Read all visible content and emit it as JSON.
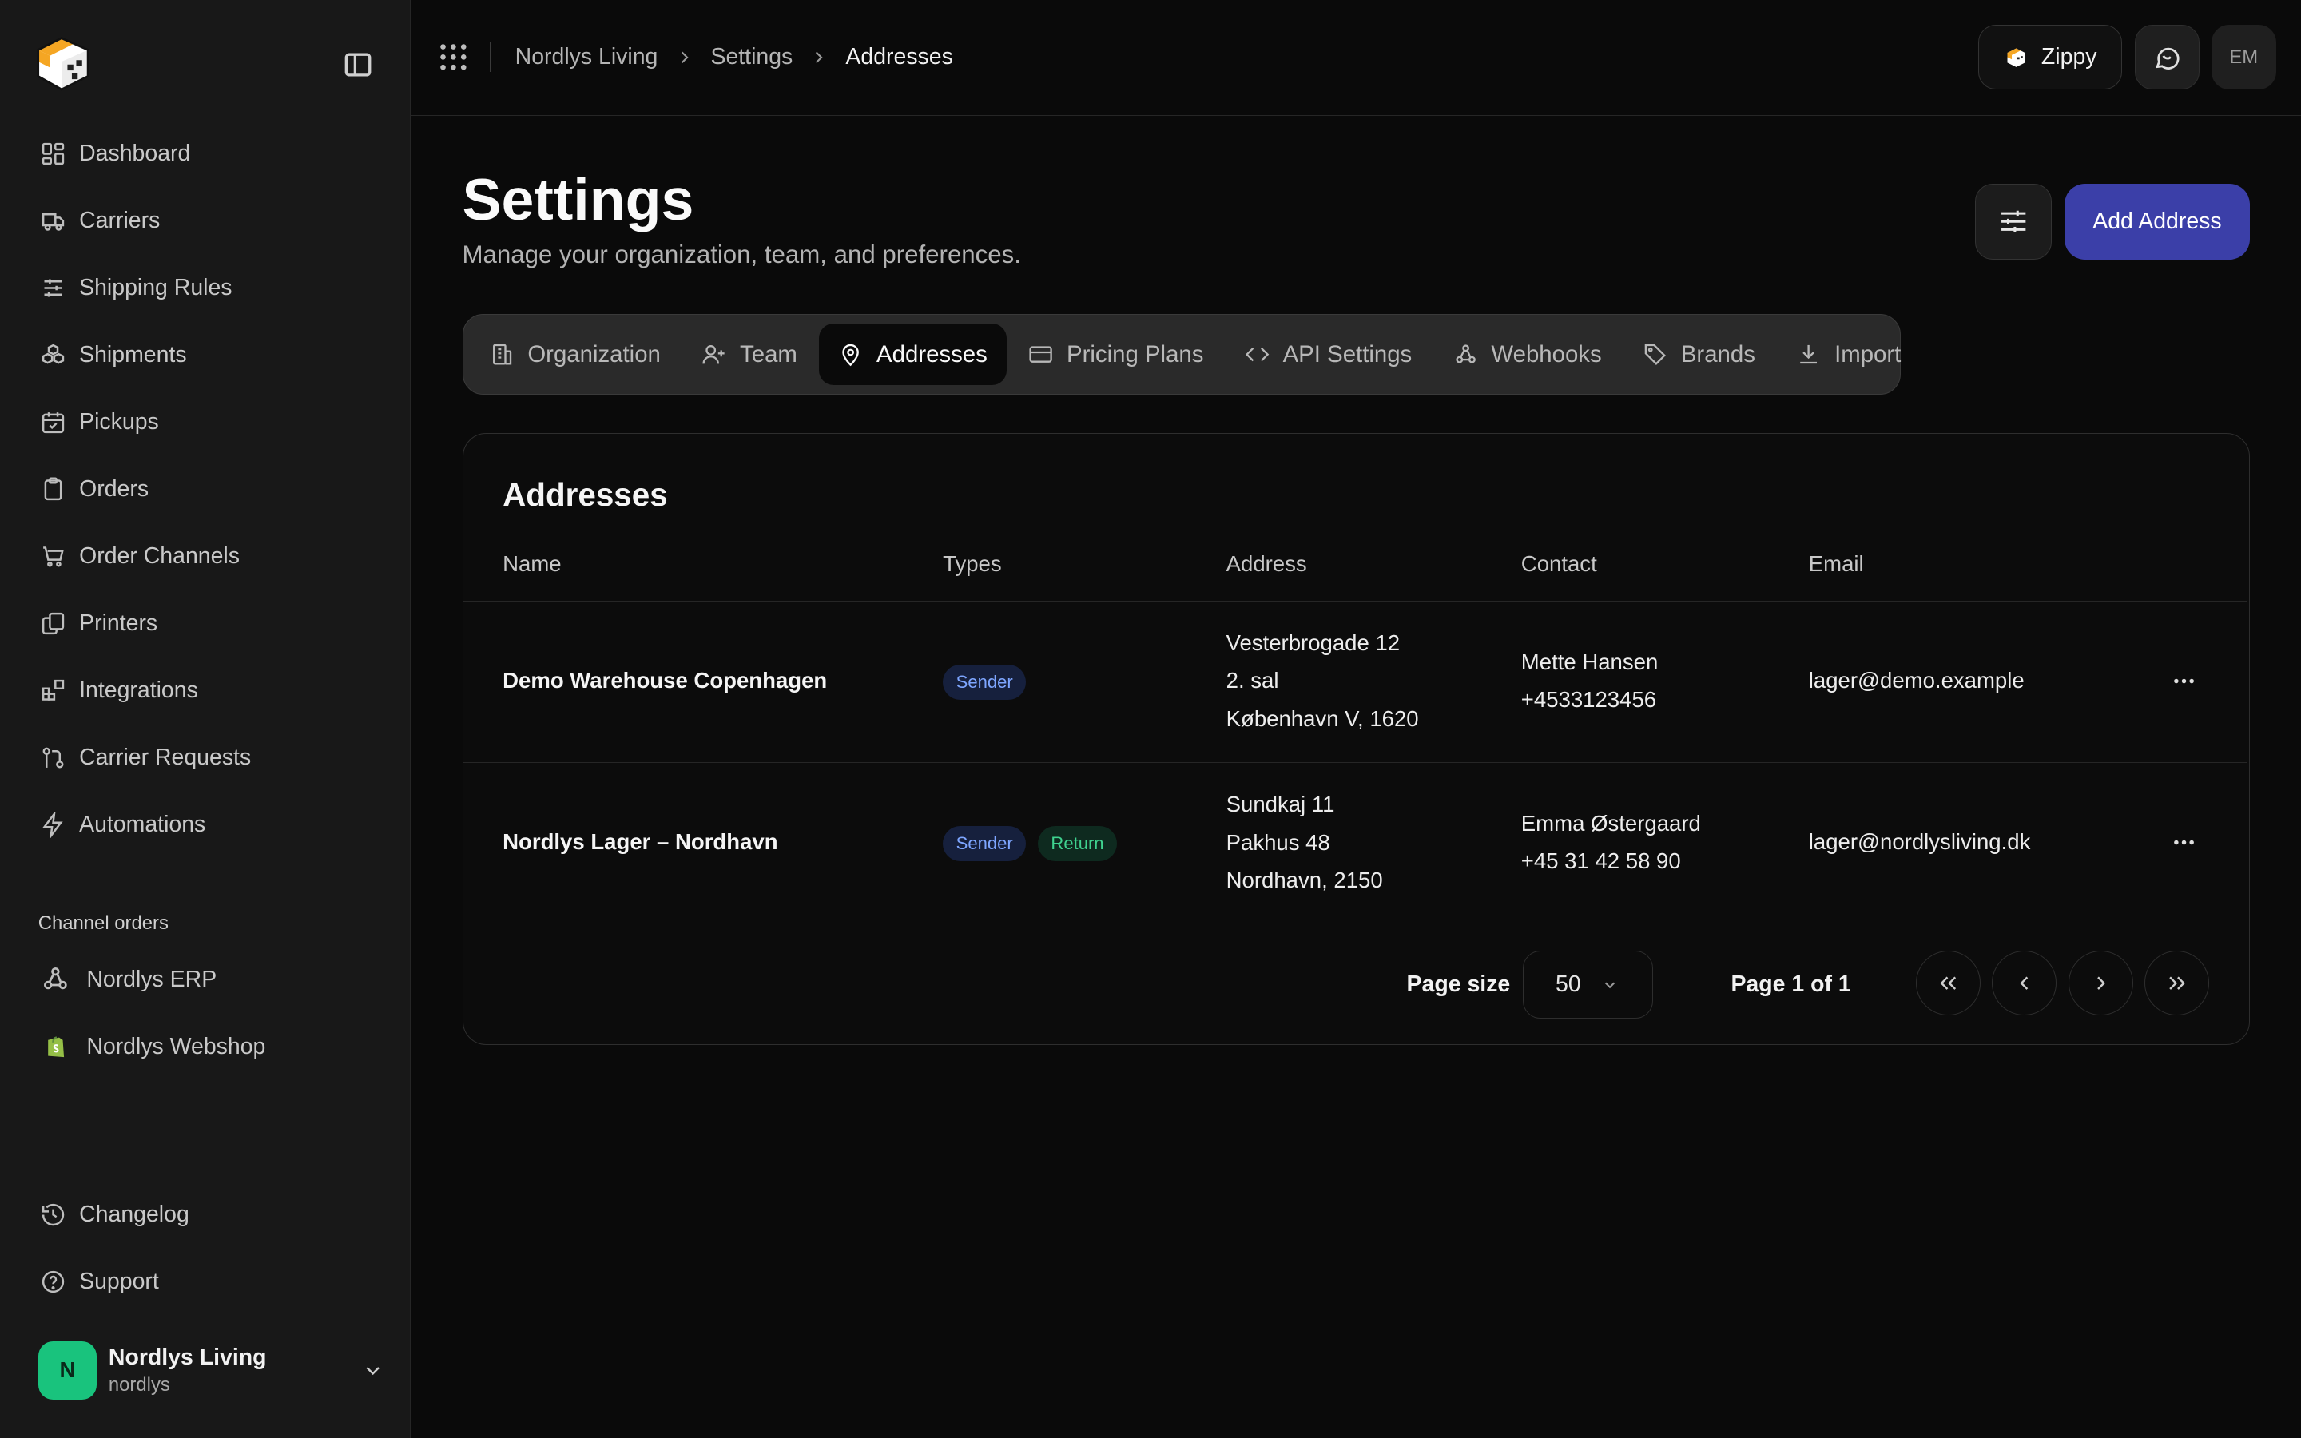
{
  "sidebar": {
    "nav": [
      {
        "label": "Dashboard",
        "icon": "layout-dashboard-icon"
      },
      {
        "label": "Carriers",
        "icon": "truck-icon"
      },
      {
        "label": "Shipping Rules",
        "icon": "sliders-icon"
      },
      {
        "label": "Shipments",
        "icon": "boxes-icon"
      },
      {
        "label": "Pickups",
        "icon": "calendar-check-icon"
      },
      {
        "label": "Orders",
        "icon": "clipboard-icon"
      },
      {
        "label": "Order Channels",
        "icon": "shopping-cart-icon"
      },
      {
        "label": "Printers",
        "icon": "copy-icon"
      },
      {
        "label": "Integrations",
        "icon": "blocks-icon"
      },
      {
        "label": "Carrier Requests",
        "icon": "git-pull-request-icon"
      },
      {
        "label": "Automations",
        "icon": "zap-icon"
      }
    ],
    "channel_section_title": "Channel orders",
    "channels": [
      {
        "label": "Nordlys ERP",
        "icon": "webhook-icon"
      },
      {
        "label": "Nordlys Webshop",
        "icon": "shopify-icon"
      }
    ],
    "bottom": [
      {
        "label": "Changelog",
        "icon": "history-icon"
      },
      {
        "label": "Support",
        "icon": "help-circle-icon"
      }
    ],
    "org": {
      "initial": "N",
      "name": "Nordlys Living",
      "slug": "nordlys"
    }
  },
  "topbar": {
    "breadcrumb": [
      "Nordlys Living",
      "Settings",
      "Addresses"
    ],
    "zippy_label": "Zippy",
    "user_initials": "EM"
  },
  "page": {
    "title": "Settings",
    "subtitle": "Manage your organization, team, and preferences.",
    "add_button": "Add Address"
  },
  "tabs": [
    {
      "label": "Organization",
      "icon": "building-icon",
      "active": false
    },
    {
      "label": "Team",
      "icon": "user-plus-icon",
      "active": false
    },
    {
      "label": "Addresses",
      "icon": "map-pin-icon",
      "active": true
    },
    {
      "label": "Pricing Plans",
      "icon": "credit-card-icon",
      "active": false
    },
    {
      "label": "API Settings",
      "icon": "code-icon",
      "active": false
    },
    {
      "label": "Webhooks",
      "icon": "webhook-icon",
      "active": false
    },
    {
      "label": "Brands",
      "icon": "tag-icon",
      "active": false
    },
    {
      "label": "Import",
      "icon": "download-icon",
      "active": false
    }
  ],
  "addresses": {
    "title": "Addresses",
    "columns": [
      "Name",
      "Types",
      "Address",
      "Contact",
      "Email"
    ],
    "rows": [
      {
        "name": "Demo Warehouse Copenhagen",
        "types": [
          "Sender"
        ],
        "address_lines": [
          "Vesterbrogade 12",
          "2. sal",
          "København V, 1620"
        ],
        "contact_name": "Mette Hansen",
        "contact_phone": "+4533123456",
        "email": "lager@demo.example"
      },
      {
        "name": "Nordlys Lager – Nordhavn",
        "types": [
          "Sender",
          "Return"
        ],
        "address_lines": [
          "Sundkaj 11",
          "Pakhus 48",
          "Nordhavn, 2150"
        ],
        "contact_name": "Emma Østergaard",
        "contact_phone": "+45 31 42 58 90",
        "email": "lager@nordlysliving.dk"
      }
    ],
    "pagination": {
      "page_size_label": "Page size",
      "page_size": "50",
      "page_info": "Page 1 of 1"
    }
  },
  "colors": {
    "accent": "#3b3fa8",
    "org_avatar": "#19c37d",
    "badge_sender": "#7ea6ff",
    "badge_return": "#3fd28f"
  }
}
